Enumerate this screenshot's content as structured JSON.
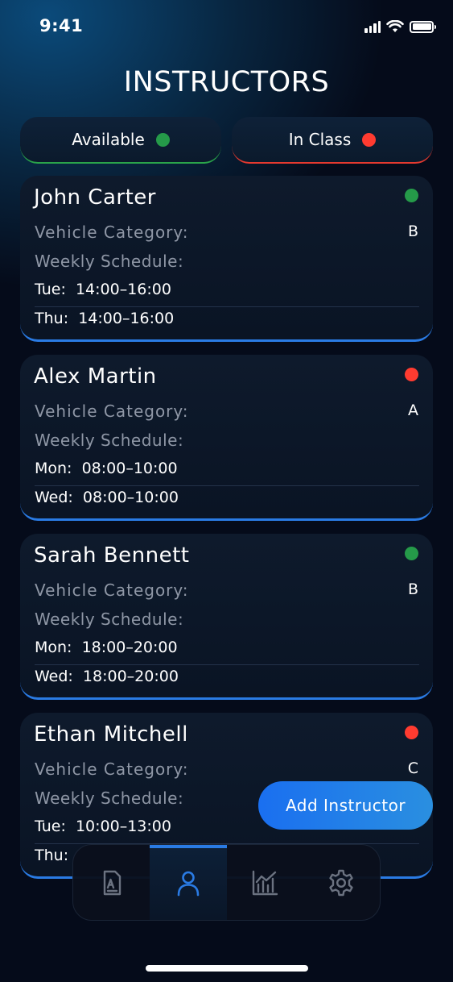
{
  "status_bar": {
    "time": "9:41"
  },
  "header": {
    "title": "INSTRUCTORS"
  },
  "filters": [
    {
      "label": "Available",
      "color": "#259a49"
    },
    {
      "label": "In Class",
      "color": "#ff3b30"
    }
  ],
  "labels": {
    "vehicle_category": "Vehicle Category:",
    "weekly_schedule": "Weekly Schedule:"
  },
  "instructors": [
    {
      "name": "John Carter",
      "status": "available",
      "status_color": "#259a49",
      "category": "B",
      "schedule": [
        {
          "day": "Tue:",
          "time": "14:00–16:00"
        },
        {
          "day": "Thu:",
          "time": "14:00–16:00"
        }
      ]
    },
    {
      "name": "Alex Martin",
      "status": "in-class",
      "status_color": "#ff3b30",
      "category": "A",
      "schedule": [
        {
          "day": "Mon:",
          "time": "08:00–10:00"
        },
        {
          "day": "Wed:",
          "time": "08:00–10:00"
        }
      ]
    },
    {
      "name": "Sarah Bennett",
      "status": "available",
      "status_color": "#259a49",
      "category": "B",
      "schedule": [
        {
          "day": "Mon:",
          "time": "18:00–20:00"
        },
        {
          "day": "Wed:",
          "time": "18:00–20:00"
        }
      ]
    },
    {
      "name": "Ethan Mitchell",
      "status": "in-class",
      "status_color": "#ff3b30",
      "category": "C",
      "schedule": [
        {
          "day": "Tue:",
          "time": "10:00–13:00"
        },
        {
          "day": "Thu:",
          "time": ""
        }
      ]
    }
  ],
  "add_button": {
    "label": "Add Instructor"
  },
  "tabs": [
    {
      "icon": "document-icon",
      "active": false
    },
    {
      "icon": "person-icon",
      "active": true
    },
    {
      "icon": "chart-icon",
      "active": false
    },
    {
      "icon": "gear-icon",
      "active": false
    }
  ],
  "colors": {
    "accent": "#2a7be4",
    "available": "#259a49",
    "in_class": "#ff3b30",
    "muted_text": "#8f97a6"
  }
}
